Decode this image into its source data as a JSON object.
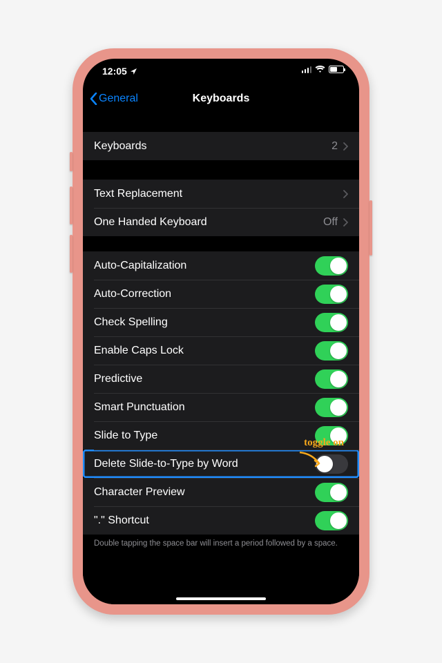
{
  "status": {
    "time": "12:05",
    "location_icon": "location-arrow"
  },
  "nav": {
    "back_label": "General",
    "title": "Keyboards"
  },
  "group_keyboards": {
    "label": "Keyboards",
    "value": "2"
  },
  "group_options": {
    "text_replacement": {
      "label": "Text Replacement"
    },
    "one_handed": {
      "label": "One Handed Keyboard",
      "value": "Off"
    }
  },
  "toggles": [
    {
      "label": "Auto-Capitalization",
      "on": true
    },
    {
      "label": "Auto-Correction",
      "on": true
    },
    {
      "label": "Check Spelling",
      "on": true
    },
    {
      "label": "Enable Caps Lock",
      "on": true
    },
    {
      "label": "Predictive",
      "on": true
    },
    {
      "label": "Smart Punctuation",
      "on": true
    },
    {
      "label": "Slide to Type",
      "on": true
    },
    {
      "label": "Delete Slide-to-Type by Word",
      "on": false,
      "highlight": true
    },
    {
      "label": "Character Preview",
      "on": true
    },
    {
      "label": "\".\" Shortcut",
      "on": true
    }
  ],
  "footer": "Double tapping the space bar will insert a period followed by a space.",
  "annotation": "toggle on"
}
